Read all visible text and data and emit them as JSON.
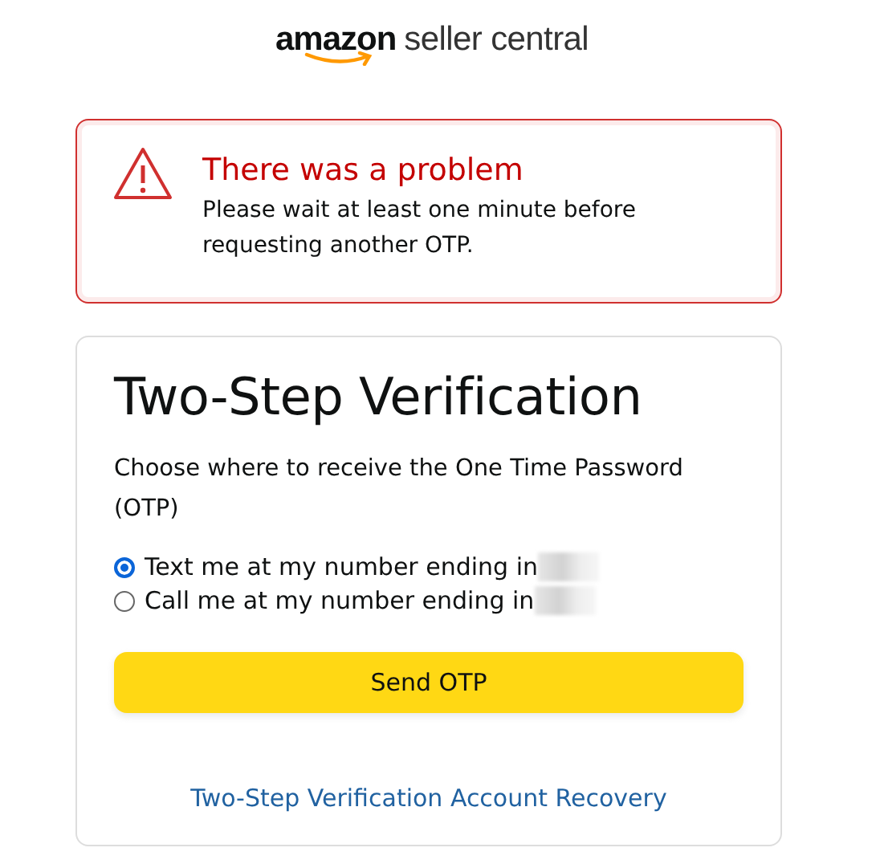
{
  "logo": {
    "brand": "amazon",
    "product": "seller central"
  },
  "alert": {
    "title": "There was a problem",
    "message": "Please wait at least one minute before requesting another OTP."
  },
  "card": {
    "title": "Two-Step Verification",
    "instructions": "Choose where to receive the One Time Password (OTP)",
    "options": [
      {
        "label": "Text me at my number ending in",
        "selected": true
      },
      {
        "label": "Call me at my number ending in",
        "selected": false
      }
    ],
    "button": "Send OTP",
    "link": "Two-Step Verification Account Recovery"
  }
}
